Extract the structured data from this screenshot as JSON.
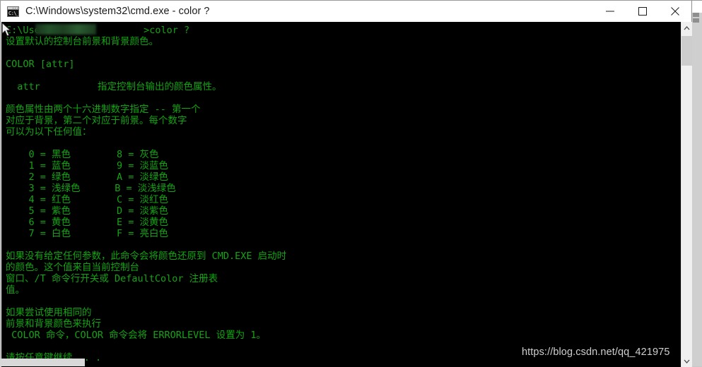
{
  "window": {
    "title": "C:\\Windows\\system32\\cmd.exe - color  ?",
    "icon_name": "cmd-exe-icon",
    "icon_glyph": "C:\\_",
    "controls": {
      "minimize_label": "Minimize",
      "maximize_label": "Maximize",
      "close_label": "Close"
    }
  },
  "terminal": {
    "foreground_color": "#13a413",
    "background_color": "#000000",
    "prompt_line": "C:\\Users                >color ?",
    "lines": [
      "C:\\Users                >color ?",
      "设置默认的控制台前景和背景颜色。",
      "",
      "COLOR [attr]",
      "",
      "  attr          指定控制台输出的颜色属性。",
      "",
      "颜色属性由两个十六进制数字指定 -- 第一个",
      "对应于背景，第二个对应于前景。每个数字",
      "可以为以下任何值：",
      "",
      "    0 = 黑色        8 = 灰色",
      "    1 = 蓝色        9 = 淡蓝色",
      "    2 = 绿色        A = 淡绿色",
      "    3 = 浅绿色      B = 淡浅绿色",
      "    4 = 红色        C = 淡红色",
      "    5 = 紫色        D = 淡紫色",
      "    6 = 黄色        E = 淡黄色",
      "    7 = 白色        F = 亮白色",
      "",
      "如果没有给定任何参数，此命令会将颜色还原到 CMD.EXE 启动时",
      "的颜色。这个值来自当前控制台",
      "窗口、/T 命令行开关或 DefaultColor 注册表",
      "值。",
      "",
      "如果尝试使用相同的",
      "前景和背景颜色来执行",
      " COLOR 命令，COLOR 命令会将 ERRORLEVEL 设置为 1。",
      "",
      "请按任意键继续. . ."
    ],
    "color_table": {
      "left_column": [
        {
          "code": "0",
          "name": "黑色"
        },
        {
          "code": "1",
          "name": "蓝色"
        },
        {
          "code": "2",
          "name": "绿色"
        },
        {
          "code": "3",
          "name": "浅绿色"
        },
        {
          "code": "4",
          "name": "红色"
        },
        {
          "code": "5",
          "name": "紫色"
        },
        {
          "code": "6",
          "name": "黄色"
        },
        {
          "code": "7",
          "name": "白色"
        }
      ],
      "right_column": [
        {
          "code": "8",
          "name": "灰色"
        },
        {
          "code": "9",
          "name": "淡蓝色"
        },
        {
          "code": "A",
          "name": "淡绿色"
        },
        {
          "code": "B",
          "name": "淡浅绿色"
        },
        {
          "code": "C",
          "name": "淡红色"
        },
        {
          "code": "D",
          "name": "淡紫色"
        },
        {
          "code": "E",
          "name": "淡黄色"
        },
        {
          "code": "F",
          "name": "亮白色"
        }
      ]
    },
    "command_entered": "color ?",
    "pause_prompt": "请按任意键继续. . ."
  },
  "scrollbar": {
    "up_arrow_name": "scroll-up-arrow",
    "down_arrow_name": "scroll-down-arrow",
    "thumb_name": "scrollbar-thumb"
  },
  "watermark": {
    "text": "https://blog.csdn.net/qq_421975"
  }
}
